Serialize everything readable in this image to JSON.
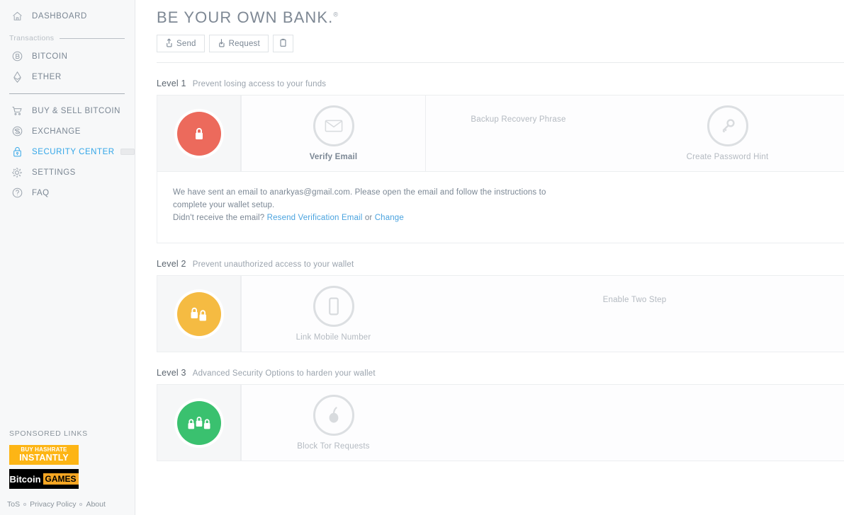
{
  "sidebar": {
    "nav_top": [
      {
        "label": "DASHBOARD",
        "icon": "home-icon",
        "id": "dashboard"
      }
    ],
    "transactions_section_label": "Transactions",
    "nav_transactions": [
      {
        "label": "BITCOIN",
        "icon": "bitcoin-icon",
        "id": "bitcoin"
      },
      {
        "label": "ETHER",
        "icon": "ether-icon",
        "id": "ether"
      }
    ],
    "nav_main": [
      {
        "label": "BUY & SELL BITCOIN",
        "icon": "cart-icon",
        "id": "buy-sell-bitcoin"
      },
      {
        "label": "EXCHANGE",
        "icon": "exchange-icon",
        "id": "exchange"
      },
      {
        "label": "SECURITY CENTER",
        "icon": "lock-icon",
        "id": "security-center",
        "active": true,
        "progress_percent": 12
      },
      {
        "label": "SETTINGS",
        "icon": "gear-icon",
        "id": "settings"
      },
      {
        "label": "FAQ",
        "icon": "question-icon",
        "id": "faq"
      }
    ],
    "sponsored_title": "SPONSORED LINKS",
    "ads": [
      {
        "id": "buy-hashrate",
        "line1": "BUY HASHRATE",
        "line2": "INSTANTLY"
      },
      {
        "id": "bitcoin-games",
        "word1": "Bitcoin",
        "word2": "GAMES"
      }
    ],
    "footer_links": [
      {
        "label": "ToS"
      },
      {
        "label": "Privacy Policy"
      },
      {
        "label": "About"
      }
    ]
  },
  "header": {
    "title": "BE YOUR OWN BANK.",
    "title_mark": "®",
    "send_label": "Send",
    "request_label": "Request",
    "clipboard_icon": "clipboard-icon"
  },
  "levels": [
    {
      "name": "Level 1",
      "desc": "Prevent losing access to your funds",
      "badge_color": "#ec6a5c",
      "badge_icon": "single-lock-icon",
      "steps": [
        {
          "label": "Verify Email",
          "icon": "envelope-icon",
          "state": "done",
          "has_icon": true
        },
        {
          "label": "Backup Recovery Phrase",
          "icon": "none",
          "state": "todo",
          "has_icon": false
        },
        {
          "label": "Create Password Hint",
          "icon": "key-icon",
          "state": "todo",
          "has_icon": true
        }
      ],
      "body": {
        "line1_prefix": "We have sent an email to ",
        "email": "anarkyas@gmail.com",
        "line1_suffix": ". Please open the email and follow the instructions to complete your wallet setup.",
        "line2_prefix": "Didn't receive the email? ",
        "resend_label": "Resend Verification Email",
        "line2_middle": " or ",
        "change_label": "Change"
      }
    },
    {
      "name": "Level 2",
      "desc": "Prevent unauthorized access to your wallet",
      "badge_color": "#f5bb42",
      "badge_icon": "double-lock-icon",
      "steps": [
        {
          "label": "Link Mobile Number",
          "icon": "mobile-icon",
          "state": "todo",
          "has_icon": true
        },
        {
          "label": "Enable Two Step",
          "icon": "none",
          "state": "todo",
          "has_icon": false
        }
      ]
    },
    {
      "name": "Level 3",
      "desc": "Advanced Security Options to harden your wallet",
      "badge_color": "#3ac16f",
      "badge_icon": "triple-lock-icon",
      "steps": [
        {
          "label": "Block Tor Requests",
          "icon": "tor-onion-icon",
          "state": "todo",
          "has_icon": true
        }
      ]
    }
  ],
  "colors": {
    "accent_blue": "#33a6e8",
    "link_blue": "#4aa3df",
    "level1": "#ec6a5c",
    "level2": "#f5bb42",
    "level3": "#3ac16f",
    "progress": "#d0021b"
  }
}
